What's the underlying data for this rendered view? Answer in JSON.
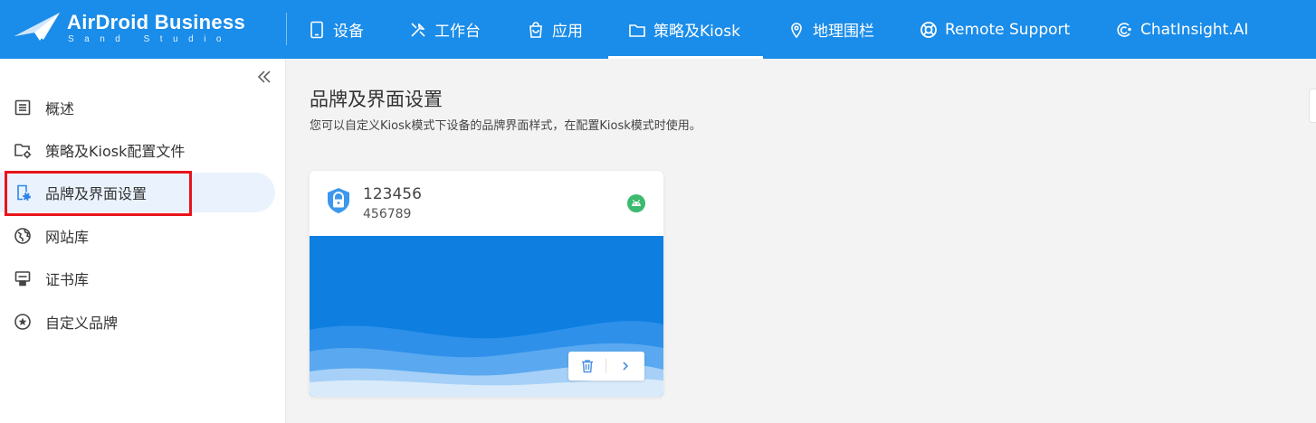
{
  "brand": {
    "title": "AirDroid Business",
    "subtitle": "Sand Studio"
  },
  "nav": [
    {
      "label": "设备",
      "icon": "tablet-icon"
    },
    {
      "label": "工作台",
      "icon": "tools-icon"
    },
    {
      "label": "应用",
      "icon": "shopping-bag-icon"
    },
    {
      "label": "策略及Kiosk",
      "icon": "folder-icon",
      "active": true
    },
    {
      "label": "地理围栏",
      "icon": "map-pin-icon"
    },
    {
      "label": "Remote Support",
      "icon": "lifebuoy-icon"
    },
    {
      "label": "ChatInsight.AI",
      "icon": "chatinsight-icon"
    }
  ],
  "sidebar": {
    "items": [
      {
        "label": "概述",
        "icon": "list-icon"
      },
      {
        "label": "策略及Kiosk配置文件",
        "icon": "folder-settings-icon"
      },
      {
        "label": "品牌及界面设置",
        "icon": "device-settings-icon",
        "active": true
      },
      {
        "label": "网站库",
        "icon": "globe-icon"
      },
      {
        "label": "证书库",
        "icon": "certificate-icon"
      },
      {
        "label": "自定义品牌",
        "icon": "star-circle-icon"
      }
    ]
  },
  "main": {
    "title": "品牌及界面设置",
    "description": "您可以自定义Kiosk模式下设备的品牌界面样式，在配置Kiosk模式时使用。"
  },
  "card": {
    "name": "123456",
    "subtitle": "456789",
    "platform_icon": "android-icon"
  },
  "colors": {
    "topbar": "#1a8ce9",
    "card_preview": "#0e7fe1",
    "highlight": "#e8141b",
    "active_bg": "#eaf3fd",
    "android": "#3cba6f"
  }
}
